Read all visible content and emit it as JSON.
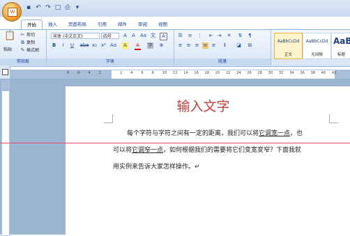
{
  "quick_access": [
    "save-icon",
    "undo-icon",
    "redo-icon",
    "new-icon",
    "print-icon",
    "customize-icon"
  ],
  "tabs": [
    "开始",
    "插入",
    "页面布局",
    "引用",
    "邮件",
    "审阅",
    "视图"
  ],
  "clipboard": {
    "paste": "粘贴",
    "cut": "剪切",
    "copy": "复制",
    "format_painter": "格式刷",
    "label": "剪贴板"
  },
  "font": {
    "name": "宋体 (中文正文)",
    "size": "四号",
    "label": "字体",
    "toolbar1": [
      "A",
      "A",
      "Aa",
      "文",
      "A"
    ],
    "toolbar2": [
      "B",
      "I",
      "U",
      "abe",
      "x₂",
      "x²",
      "Aa",
      "A",
      "A",
      "字"
    ]
  },
  "paragraph": {
    "label": "段落"
  },
  "styles": [
    {
      "sample": "AaBbCcDd",
      "name": "正文"
    },
    {
      "sample": "AaBbCcDd",
      "name": "无间隔"
    },
    {
      "sample": "AaB",
      "name": "标题"
    }
  ],
  "ruler_ticks": [
    "8",
    "6",
    "4",
    "2",
    "",
    "2",
    "4",
    "6",
    "8",
    "10",
    "12",
    "14",
    "16",
    "18",
    "20",
    "22",
    "24",
    "26",
    "28",
    "30",
    "32",
    "34",
    "36",
    "38",
    "40",
    "42"
  ],
  "document": {
    "title": "输入文字",
    "line1_a": "每个字符与字符之间有一定的距离，我们可以将",
    "line1_b": "它调宽一点",
    "line1_c": "，也",
    "line2_a": "可以将",
    "line2_b": "它调窄一点",
    "line2_c": "，如何根据我们的需要将它们变宽变窄？下面我就",
    "line3": "用实例来告诉大家怎样操作。↵"
  },
  "colors": {
    "title": "#c0403c",
    "accent": "#15428b"
  }
}
